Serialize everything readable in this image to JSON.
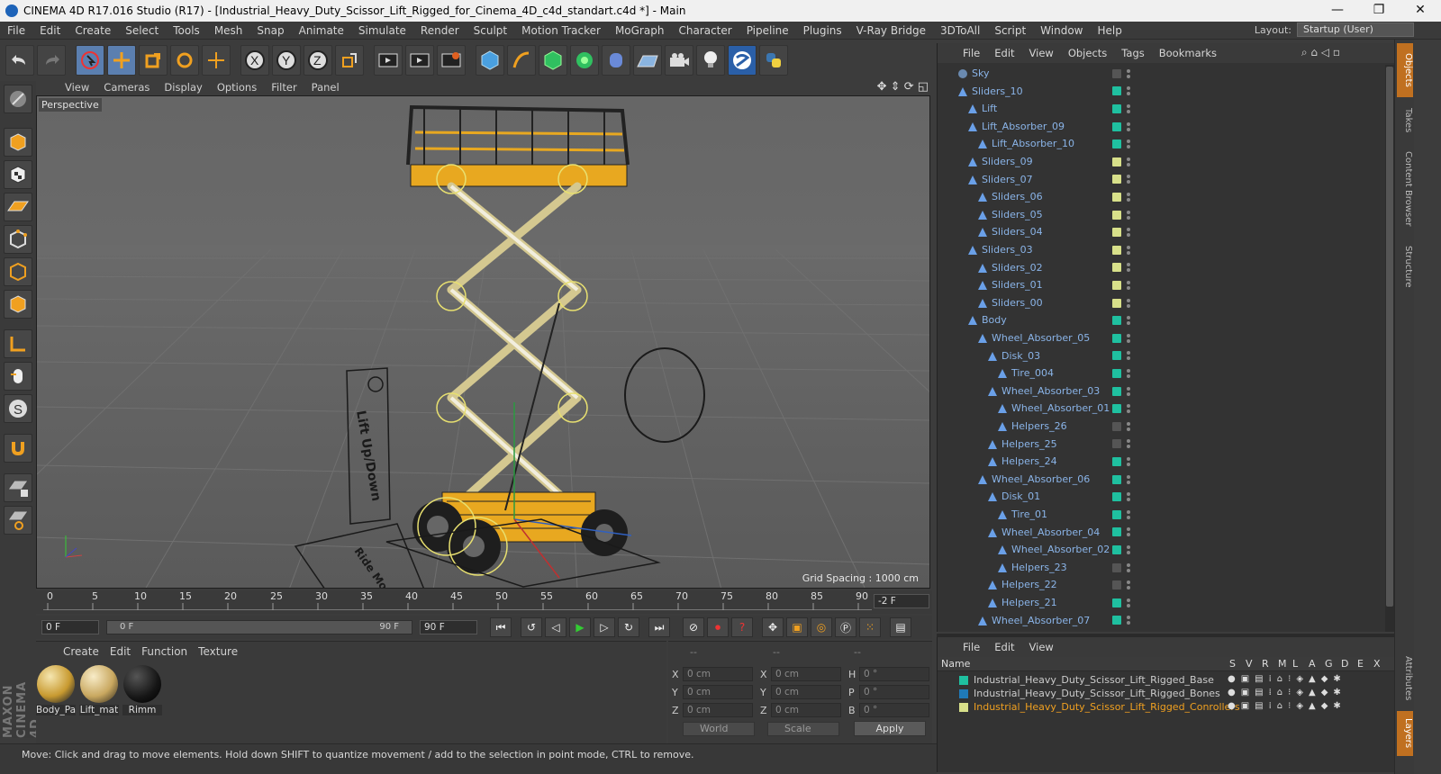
{
  "window": {
    "title": "CINEMA 4D R17.016 Studio (R17) - [Industrial_Heavy_Duty_Scissor_Lift_Rigged_for_Cinema_4D_c4d_standart.c4d *] - Main",
    "minimize": "—",
    "maximize": "❐",
    "close": "✕"
  },
  "menu": [
    "File",
    "Edit",
    "Create",
    "Select",
    "Tools",
    "Mesh",
    "Snap",
    "Animate",
    "Simulate",
    "Render",
    "Sculpt",
    "Motion Tracker",
    "MoGraph",
    "Character",
    "Pipeline",
    "Plugins",
    "V-Ray Bridge",
    "3DToAll",
    "Script",
    "Window",
    "Help"
  ],
  "layout": {
    "label": "Layout:",
    "value": "Startup (User)"
  },
  "viewport": {
    "menu": [
      "View",
      "Cameras",
      "Display",
      "Options",
      "Filter",
      "Panel"
    ],
    "label": "Perspective",
    "grid_spacing": "Grid Spacing : 1000 cm",
    "sign_text": "Lift Up/Down",
    "floor_text": "Ride Mode"
  },
  "timeline": {
    "ticks": [
      "0",
      "5",
      "10",
      "15",
      "20",
      "25",
      "30",
      "35",
      "40",
      "45",
      "50",
      "55",
      "60",
      "65",
      "70",
      "75",
      "80",
      "85",
      "90"
    ],
    "current_end": "-2 F",
    "start_field": "0 F",
    "range_start": "0 F",
    "range_end": "90 F",
    "end_field": "90 F"
  },
  "material_panel": {
    "menu": [
      "Create",
      "Edit",
      "Function",
      "Texture"
    ],
    "materials": [
      {
        "name": "Body_Pa"
      },
      {
        "name": "Lift_mat"
      },
      {
        "name": "Rimm"
      }
    ]
  },
  "coords": {
    "headers": [
      "--",
      "--",
      "--"
    ],
    "rows": [
      {
        "a": "X",
        "av": "0 cm",
        "b": "X",
        "bv": "0 cm",
        "c": "H",
        "cv": "0 °"
      },
      {
        "a": "Y",
        "av": "0 cm",
        "b": "Y",
        "bv": "0 cm",
        "c": "P",
        "cv": "0 °"
      },
      {
        "a": "Z",
        "av": "0 cm",
        "b": "Z",
        "bv": "0 cm",
        "c": "B",
        "cv": "0 °"
      }
    ],
    "world": "World",
    "scale": "Scale",
    "apply": "Apply"
  },
  "status": "Move: Click and drag to move elements. Hold down SHIFT to quantize movement / add to the selection in point mode, CTRL to remove.",
  "object_manager": {
    "menu": [
      "File",
      "Edit",
      "View",
      "Objects",
      "Tags",
      "Bookmarks"
    ],
    "objects": [
      {
        "name": "Sky",
        "depth": 0,
        "color": "#555555"
      },
      {
        "name": "Sliders_10",
        "depth": 0,
        "color": "#1fc0a0"
      },
      {
        "name": "Lift",
        "depth": 1,
        "color": "#1fc0a0"
      },
      {
        "name": "Lift_Absorber_09",
        "depth": 1,
        "color": "#1fc0a0"
      },
      {
        "name": "Lift_Absorber_10",
        "depth": 2,
        "color": "#1fc0a0"
      },
      {
        "name": "Sliders_09",
        "depth": 1,
        "color": "#d8e08a"
      },
      {
        "name": "Sliders_07",
        "depth": 1,
        "color": "#d8e08a"
      },
      {
        "name": "Sliders_06",
        "depth": 2,
        "color": "#d8e08a"
      },
      {
        "name": "Sliders_05",
        "depth": 2,
        "color": "#d8e08a"
      },
      {
        "name": "Sliders_04",
        "depth": 2,
        "color": "#d8e08a"
      },
      {
        "name": "Sliders_03",
        "depth": 1,
        "color": "#d8e08a"
      },
      {
        "name": "Sliders_02",
        "depth": 2,
        "color": "#d8e08a"
      },
      {
        "name": "Sliders_01",
        "depth": 2,
        "color": "#d8e08a"
      },
      {
        "name": "Sliders_00",
        "depth": 2,
        "color": "#d8e08a"
      },
      {
        "name": "Body",
        "depth": 1,
        "color": "#1fc0a0"
      },
      {
        "name": "Wheel_Absorber_05",
        "depth": 2,
        "color": "#1fc0a0"
      },
      {
        "name": "Disk_03",
        "depth": 3,
        "color": "#1fc0a0"
      },
      {
        "name": "Tire_004",
        "depth": 4,
        "color": "#1fc0a0"
      },
      {
        "name": "Wheel_Absorber_03",
        "depth": 3,
        "color": "#1fc0a0"
      },
      {
        "name": "Wheel_Absorber_01",
        "depth": 4,
        "color": "#1fc0a0"
      },
      {
        "name": "Helpers_26",
        "depth": 4,
        "color": "#555555"
      },
      {
        "name": "Helpers_25",
        "depth": 3,
        "color": "#555555"
      },
      {
        "name": "Helpers_24",
        "depth": 3,
        "color": "#1fc0a0"
      },
      {
        "name": "Wheel_Absorber_06",
        "depth": 2,
        "color": "#1fc0a0"
      },
      {
        "name": "Disk_01",
        "depth": 3,
        "color": "#1fc0a0"
      },
      {
        "name": "Tire_01",
        "depth": 4,
        "color": "#1fc0a0"
      },
      {
        "name": "Wheel_Absorber_04",
        "depth": 3,
        "color": "#1fc0a0"
      },
      {
        "name": "Wheel_Absorber_02",
        "depth": 4,
        "color": "#1fc0a0"
      },
      {
        "name": "Helpers_23",
        "depth": 4,
        "color": "#555555"
      },
      {
        "name": "Helpers_22",
        "depth": 3,
        "color": "#555555"
      },
      {
        "name": "Helpers_21",
        "depth": 3,
        "color": "#1fc0a0"
      },
      {
        "name": "Wheel_Absorber_07",
        "depth": 2,
        "color": "#1fc0a0"
      }
    ]
  },
  "layer_manager": {
    "menu": [
      "File",
      "Edit",
      "View"
    ],
    "header_name": "Name",
    "header_cols": [
      "S",
      "V",
      "R",
      "M",
      "L",
      "A",
      "G",
      "D",
      "E",
      "X"
    ],
    "layers": [
      {
        "name": "Industrial_Heavy_Duty_Scissor_Lift_Rigged_Base",
        "color": "#1fc0a0",
        "highlight": false
      },
      {
        "name": "Industrial_Heavy_Duty_Scissor_Lift_Rigged_Bones",
        "color": "#1f7ab8",
        "highlight": false
      },
      {
        "name": "Industrial_Heavy_Duty_Scissor_Lift_Rigged_Conrollers",
        "color": "#d8e08a",
        "highlight": true
      }
    ]
  },
  "right_tabs": [
    "Objects",
    "Takes",
    "Content Browser",
    "Structure",
    "Attributes",
    "Layers"
  ],
  "brand": "MAXON CINEMA 4D"
}
